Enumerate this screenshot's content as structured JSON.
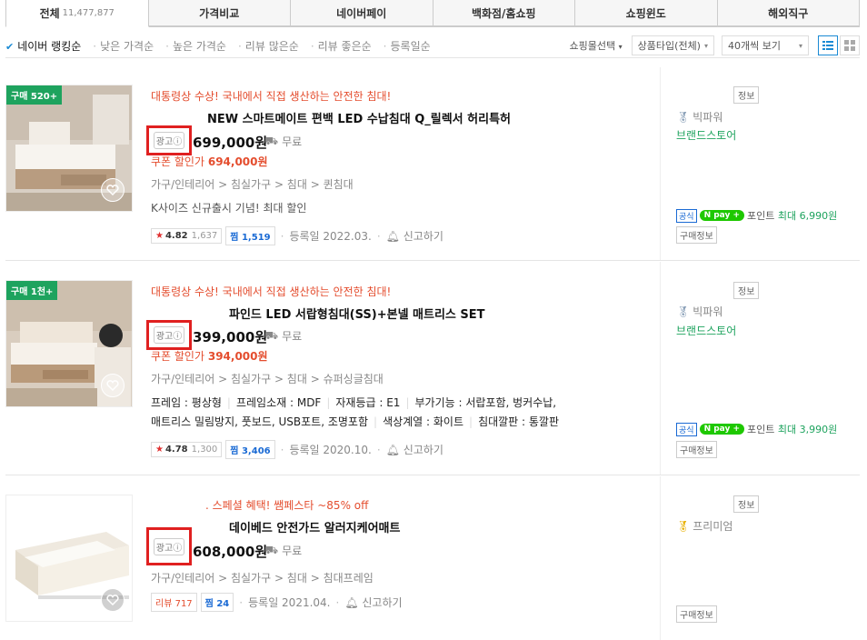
{
  "tabs": [
    {
      "label": "전체",
      "count": "11,477,877"
    },
    {
      "label": "가격비교"
    },
    {
      "label": "네이버페이"
    },
    {
      "label": "백화점/홈쇼핑"
    },
    {
      "label": "쇼핑윈도"
    },
    {
      "label": "해외직구"
    }
  ],
  "sort": {
    "options": [
      "네이버 랭킹순",
      "낮은 가격순",
      "높은 가격순",
      "리뷰 많은순",
      "리뷰 좋은순",
      "등록일순"
    ],
    "mall_select": "쇼핑몰선택",
    "product_type": "상품타입(전체)",
    "page_size": "40개씩 보기"
  },
  "items": [
    {
      "badge": "구매 520+",
      "promo": "대통령상 수상! 국내에서 직접 생산하는 안전한 침대!",
      "title": "NEW 스마트메이트 편백 LED 수납침대 Q_릴렉서 허리특허",
      "ad_label": "광고ⓘ",
      "price": "699,000원",
      "shipping": "무료",
      "coupon_label": "쿠폰 할인가",
      "coupon_price": "694,000원",
      "category": "가구/인테리어 > 침실가구 > 침대 > 퀸침대",
      "description": "K사이즈 신규출시 기념! 최대 할인",
      "rating": "4.82",
      "rating_count": "1,637",
      "zzim": "찜 1,519",
      "registered": "등록일 2022.03.",
      "report": "신고하기",
      "seller": {
        "info": "정보",
        "grade": "빅파워",
        "brandstore": "브랜드스토어",
        "official": "공식",
        "npay": "pay",
        "point_label": "포인트",
        "point_value": "최대 6,990원",
        "buy_info": "구매정보"
      }
    },
    {
      "badge": "구매 1천+",
      "promo": "대통령상 수상! 국내에서 직접 생산하는 안전한 침대!",
      "title": "파인드 LED 서랍형침대(SS)+본넬 매트리스 SET",
      "ad_label": "광고ⓘ",
      "price": "399,000원",
      "shipping": "무료",
      "coupon_label": "쿠폰 할인가",
      "coupon_price": "394,000원",
      "category": "가구/인테리어 > 침실가구 > 침대 > 슈퍼싱글침대",
      "specs_line1": [
        "프레임 : 평상형",
        "프레임소재 : MDF",
        "자재등급 : E1",
        "부가기능 : 서랍포함, 벙커수납,"
      ],
      "specs_line2": [
        "매트리스 밀림방지, 풋보드, USB포트, 조명포함",
        "색상계열 : 화이트",
        "침대깔판 : 통깔판"
      ],
      "rating": "4.78",
      "rating_count": "1,300",
      "zzim": "찜 3,406",
      "registered": "등록일 2020.10.",
      "report": "신고하기",
      "seller": {
        "info": "정보",
        "grade": "빅파워",
        "brandstore": "브랜드스토어",
        "official": "공식",
        "npay": "pay",
        "point_label": "포인트",
        "point_value": "최대 3,990원",
        "buy_info": "구매정보"
      }
    },
    {
      "promo": ". 스페셜 혜택! 쌤페스타 ~85% off",
      "title": "데이베드 안전가드 알러지케어매트",
      "ad_label": "광고ⓘ",
      "price": "608,000원",
      "shipping": "무료",
      "category": "가구/인테리어 > 침실가구 > 침대 > 침대프레임",
      "review": "리뷰 717",
      "zzim": "찜 24",
      "registered": "등록일 2021.04.",
      "report": "신고하기",
      "seller": {
        "info": "정보",
        "grade": "프리미엄",
        "buy_info": "구매정보"
      }
    }
  ]
}
